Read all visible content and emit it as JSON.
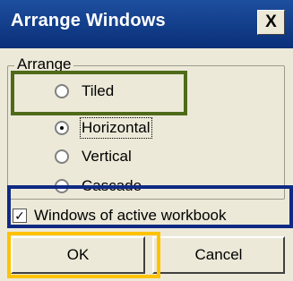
{
  "dialog": {
    "title": "Arrange Windows",
    "close_label": "X"
  },
  "arrange": {
    "group_label": "Arrange",
    "options": [
      {
        "label": "Tiled",
        "selected": false
      },
      {
        "label": "Horizontal",
        "selected": true
      },
      {
        "label": "Vertical",
        "selected": false
      },
      {
        "label": "Cascade",
        "selected": false
      }
    ]
  },
  "checkbox": {
    "label": "Windows of active workbook",
    "checked": true,
    "mark": "✓"
  },
  "buttons": {
    "ok_label": "OK",
    "cancel_label": "Cancel"
  },
  "colors": {
    "title_bar": "#0a2f78",
    "dialog_bg": "#ece9d8",
    "highlight_green": "#4f6b19",
    "highlight_blue": "#102a84",
    "highlight_yellow": "#ffc200"
  }
}
